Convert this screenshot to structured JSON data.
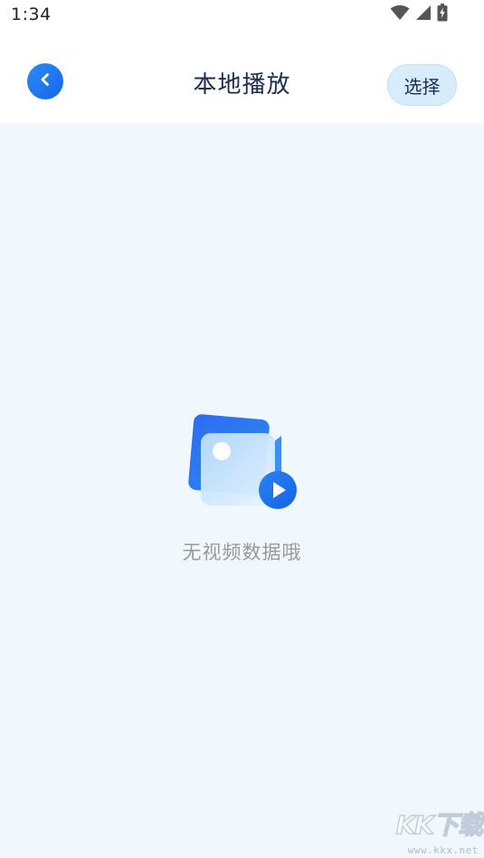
{
  "status_bar": {
    "time": "1:34",
    "icons": [
      "wifi-icon",
      "signal-icon",
      "battery-charging-icon"
    ]
  },
  "header": {
    "back_icon": "chevron-left-icon",
    "title": "本地播放",
    "select_label": "选择"
  },
  "empty_state": {
    "icon": "video-folder-play-icon",
    "message": "无视频数据哦"
  },
  "watermark": {
    "brand": "KK下载",
    "url": "www.kkx.net"
  },
  "colors": {
    "accent": "#1f7bf2",
    "background": "#f0f8fd",
    "title": "#1b2c55",
    "muted_text": "#999999",
    "select_button_bg": "#d8edfc"
  }
}
